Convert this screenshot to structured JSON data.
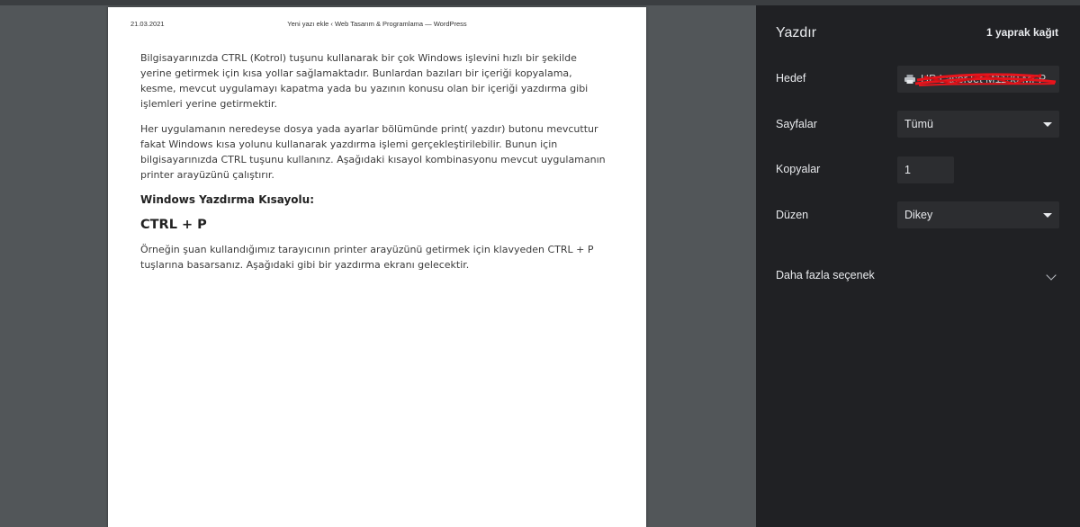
{
  "preview": {
    "header": {
      "date": "21.03.2021",
      "title": "Yeni yazı ekle ‹ Web Tasarım & Programlama — WordPress"
    },
    "body": {
      "p1": "Bilgisayarınızda CTRL (Kotrol) tuşunu kullanarak bir çok Windows işlevini hızlı bir şekilde yerine getirmek için kısa yollar sağlamaktadır. Bunlardan bazıları bir içeriği kopyalama, kesme, mevcut uygulamayı kapatma yada bu yazının konusu olan bir içeriği yazdırma gibi işlemleri yerine getirmektir.",
      "p2": "Her uygulamanın neredeyse dosya yada ayarlar bölümünde print( yazdır) butonu mevcuttur fakat Windows kısa yolunu kullanarak yazdırma işlemi gerçekleştirilebilir. Bunun için bilgisayarınızda CTRL tuşunu kullanınz. Aşağıdaki kısayol kombinasyonu mevcut uygulamanın printer arayüzünü çalıştırır.",
      "heading": "Windows Yazdırma Kısayolu:",
      "shortcut": "CTRL + P",
      "p3": "Örneğin şuan kullandığımız tarayıcının printer arayüzünü getirmek için klavyeden CTRL + P tuşlarına basarsanız. Aşağıdaki gibi bir yazdırma ekranı gelecektir."
    }
  },
  "panel": {
    "title": "Yazdır",
    "sheet_count": "1 yaprak kağıt",
    "destination": {
      "label": "Hedef",
      "value": "HP LaserJet M1130 MFP",
      "icon": "printer-icon"
    },
    "pages": {
      "label": "Sayfalar",
      "value": "Tümü"
    },
    "copies": {
      "label": "Kopyalar",
      "value": "1"
    },
    "layout": {
      "label": "Düzen",
      "value": "Dikey"
    },
    "more_settings": {
      "label": "Daha fazla seçenek",
      "icon": "chevron-down-icon"
    }
  },
  "colors": {
    "panel_bg": "#202124",
    "field_bg": "#2c2d30",
    "preview_bg": "#525659",
    "redaction": "#e8141c"
  }
}
